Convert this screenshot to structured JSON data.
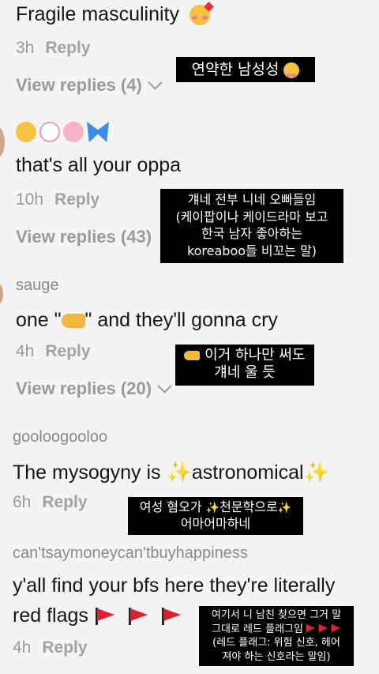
{
  "comments": [
    {
      "text": "Fragile masculinity",
      "emoji": "smiling-face-with-hearts",
      "time": "3h",
      "reply": "Reply",
      "view_replies": "View replies (4)"
    },
    {
      "emojis": [
        "relieved-face",
        "white-flower",
        "cherry-blossom",
        "butterfly"
      ],
      "text": "that's all your oppa",
      "time": "10h",
      "reply": "Reply",
      "view_replies": "View replies (43)"
    },
    {
      "user": "sauge",
      "text_before": "one \"",
      "emoji": "hand-pointing",
      "text_after": "\" and they'll gonna cry",
      "time": "4h",
      "reply": "Reply",
      "view_replies": "View replies (20)"
    },
    {
      "user": "gooloogooloo",
      "text_before": "The mysogyny is ",
      "text_mid": "astronomical",
      "time": "6h",
      "reply": "Reply"
    },
    {
      "user": "can'tsaymoneycan'tbuyhappiness",
      "line1": "y'all find your bfs here they're literally",
      "line2": "red flags",
      "time": "4h",
      "reply": "Reply"
    }
  ],
  "captions": {
    "c1": "연약한 남성성",
    "c2": [
      "걔네 전부 니네 오빠들임",
      "(케이팝이나 케이드라마 보고",
      "한국 남자 좋아하는",
      "koreaboo들 비꼬는 말)"
    ],
    "c3": [
      "이거 하나만 써도",
      "걔네 울 듯"
    ],
    "c4": [
      "여성 혐오가 ",
      "천문학으로",
      "어마어마하네"
    ],
    "c5": [
      "여기서 니 남친 찾으면 그거 말",
      "그대로 레드 플래그임",
      "(레드 플래그: 위험 신호, 헤어",
      "져야 하는 신호라는 말임)"
    ]
  },
  "colors": {
    "caption_bg": "#000000",
    "caption_text": "#ffffff",
    "flag": "#e0202a",
    "sparkle": "#f5c21b"
  }
}
